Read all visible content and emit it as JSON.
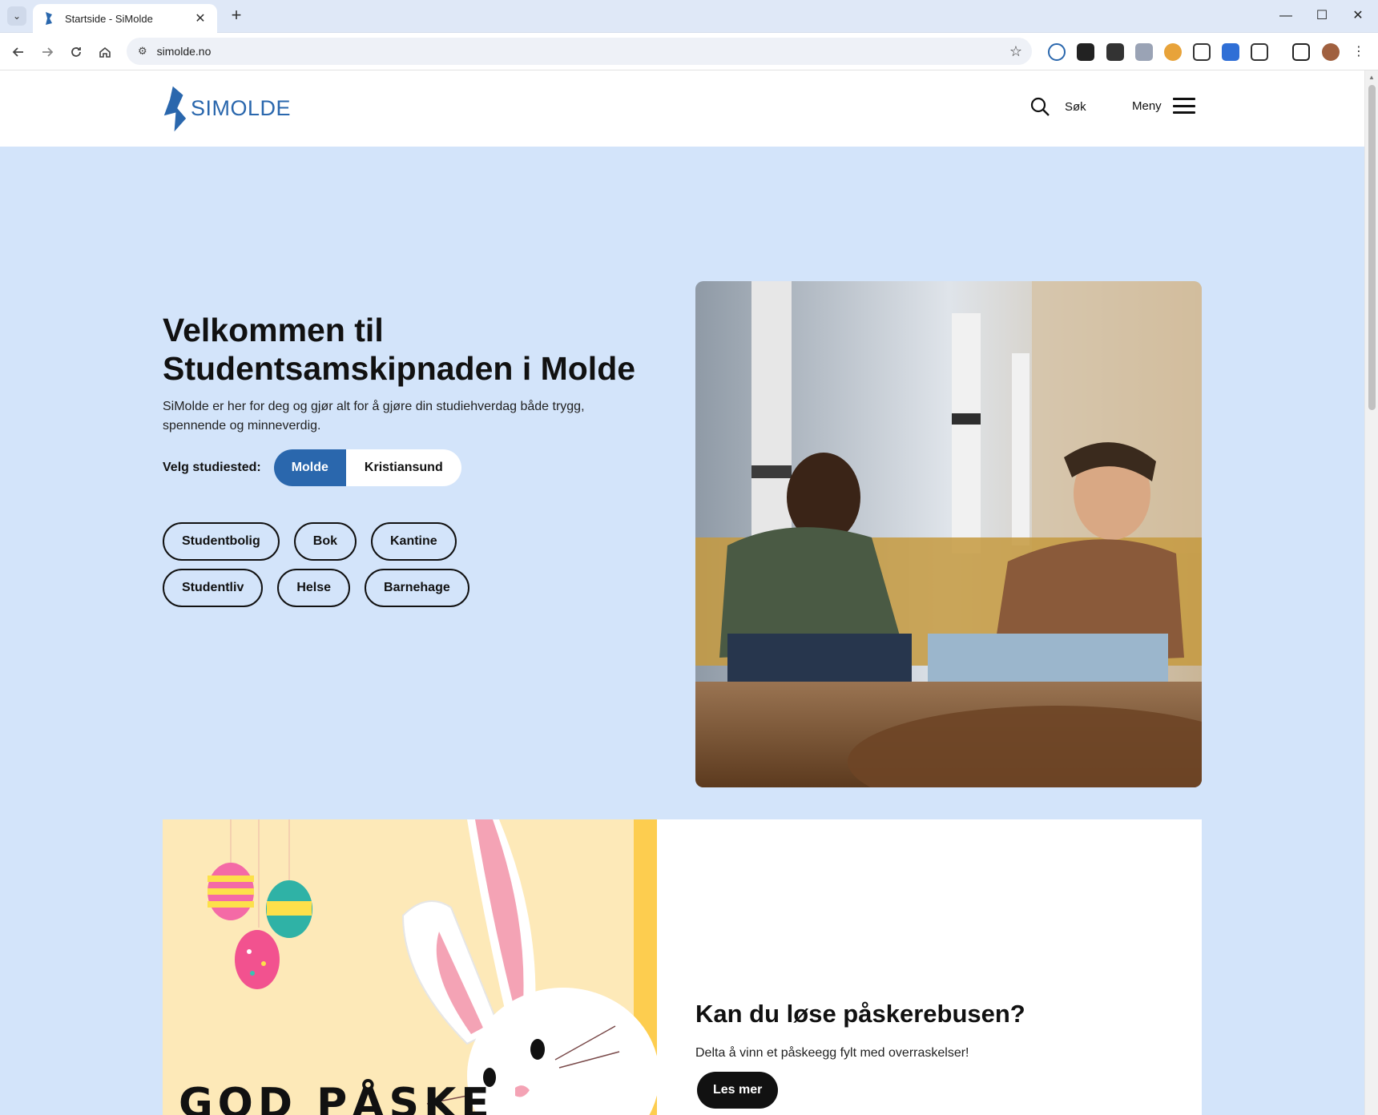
{
  "browser": {
    "tab_title": "Startside - SiMolde",
    "url": "simolde.no",
    "new_tab": "+",
    "close_tab": "✕",
    "minimize": "—",
    "maximize": "☐",
    "close_window": "✕"
  },
  "header": {
    "logo_text": "SIMOLDE",
    "search_label": "Søk",
    "menu_label": "Meny",
    "brand_color": "#2a67ad"
  },
  "hero": {
    "title_line1": "Velkommen til",
    "title_line2": "Studentsamskipnaden i Molde",
    "description": "SiMolde er her for deg og gjør alt for å gjøre din studiehverdag både trygg, spennende og minneverdig.",
    "campus_label": "Velg studiested:",
    "campus_options": [
      "Molde",
      "Kristiansund"
    ],
    "campus_selected": "Molde",
    "background_color": "#d3e4fa",
    "pills_row1": [
      "Studentbolig",
      "Bok",
      "Kantine"
    ],
    "pills_row2": [
      "Studentliv",
      "Helse",
      "Barnehage"
    ]
  },
  "promo": {
    "image_text": "GOD PÅSKE",
    "title": "Kan du løse påskerebusen?",
    "text": "Delta å vinn et påskeegg fylt med overraskelser!",
    "button_label": "Les mer"
  }
}
